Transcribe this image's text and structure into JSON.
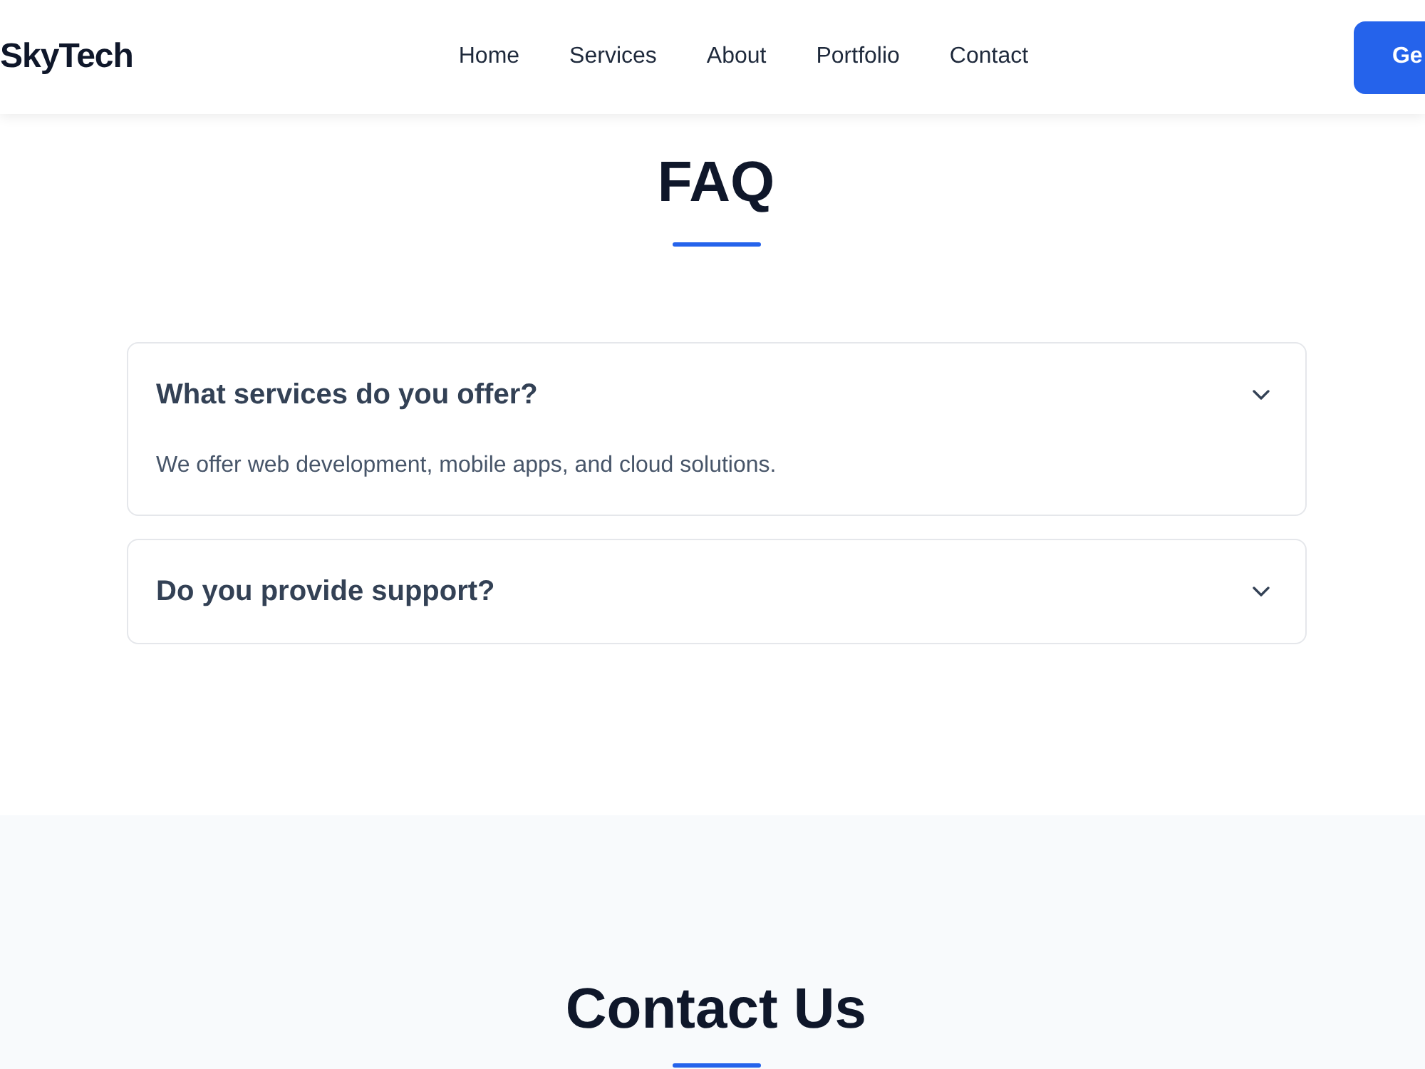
{
  "header": {
    "logo": "SkyTech",
    "nav": [
      {
        "label": "Home"
      },
      {
        "label": "Services"
      },
      {
        "label": "About"
      },
      {
        "label": "Portfolio"
      },
      {
        "label": "Contact"
      }
    ],
    "cta": "Ge"
  },
  "faq": {
    "title": "FAQ",
    "items": [
      {
        "question": "What services do you offer?",
        "answer": "We offer web development, mobile apps, and cloud solutions."
      },
      {
        "question": "Do you provide support?"
      }
    ]
  },
  "contact": {
    "title": "Contact Us"
  }
}
